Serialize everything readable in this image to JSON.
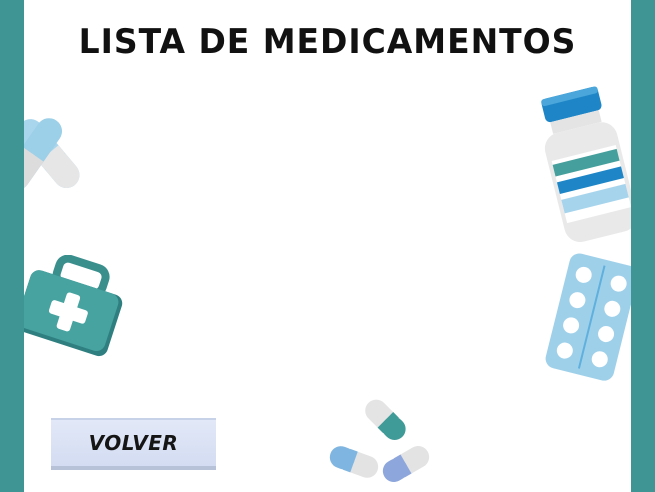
{
  "screen": {
    "title": "LISTA DE MEDICAMENTOS",
    "back_button_label": "VOLVER"
  },
  "colors": {
    "frame": "#3f9593",
    "background": "#ffffff",
    "button": "#dbe2f4",
    "capsule_blue": "#9fd0ea",
    "accent_blue": "#1e88c7"
  },
  "decorations": [
    "capsules-icon",
    "first-aid-kit-icon",
    "medicine-bottle-icon",
    "pill-blister-icon",
    "small-capsules-icon"
  ]
}
